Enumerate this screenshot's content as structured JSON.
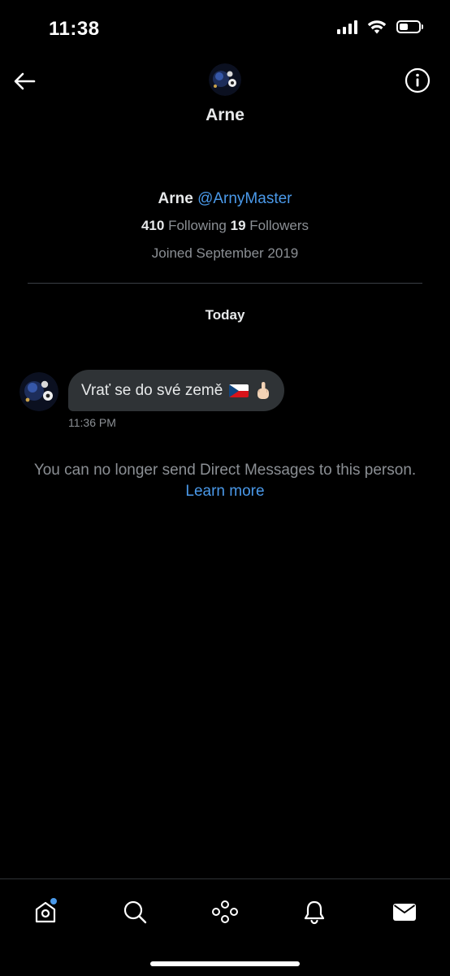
{
  "status_bar": {
    "time": "11:38",
    "battery_level": 0.45
  },
  "header": {
    "title": "Arne",
    "back_icon": "arrow-left-icon",
    "info_icon": "info-icon"
  },
  "profile": {
    "name": "Arne",
    "handle": "@ArnyMaster",
    "following_count": "410",
    "following_label": "Following",
    "followers_count": "19",
    "followers_label": "Followers",
    "joined": "Joined September 2019"
  },
  "conversation": {
    "date_label": "Today",
    "messages": [
      {
        "text": "Vrať se do své země",
        "emoji": [
          "czech-flag",
          "middle-finger"
        ],
        "time": "11:36 PM"
      }
    ]
  },
  "notice": {
    "text": "You can no longer send Direct Messages to this person.",
    "link": "Learn more"
  },
  "tab_bar": {
    "items": [
      "home-icon",
      "search-icon",
      "spaces-icon",
      "notifications-icon",
      "messages-icon"
    ],
    "accent": "#4a99e9"
  },
  "colors": {
    "background": "#000000",
    "accent": "#4a99e9",
    "bubble": "#2f3336",
    "muted": "#8b8f94"
  }
}
